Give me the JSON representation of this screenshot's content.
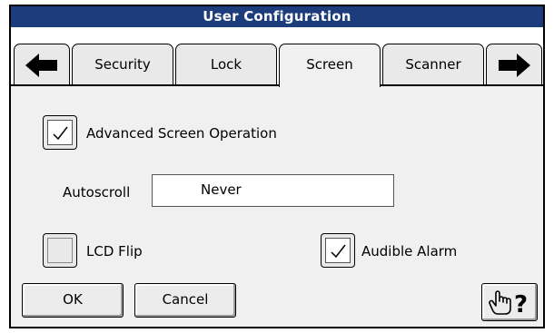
{
  "window": {
    "title": "User Configuration"
  },
  "tabs": [
    {
      "label": "Security"
    },
    {
      "label": "Lock"
    },
    {
      "label": "Screen",
      "active": true
    },
    {
      "label": "Scanner"
    }
  ],
  "icons": {
    "tab_prev": "arrow-left-icon",
    "tab_next": "arrow-right-icon",
    "help": "hand-question-icon"
  },
  "settings": {
    "advanced_screen_operation": {
      "label": "Advanced Screen Operation",
      "checked": true
    },
    "autoscroll": {
      "label": "Autoscroll",
      "value": "Never"
    },
    "lcd_flip": {
      "label": "LCD Flip",
      "checked": false
    },
    "audible_alarm": {
      "label": "Audible Alarm",
      "checked": true
    }
  },
  "buttons": {
    "ok": "OK",
    "cancel": "Cancel"
  },
  "colors": {
    "titlebar": "#1c3c7c",
    "panel": "#f0f0f0"
  }
}
